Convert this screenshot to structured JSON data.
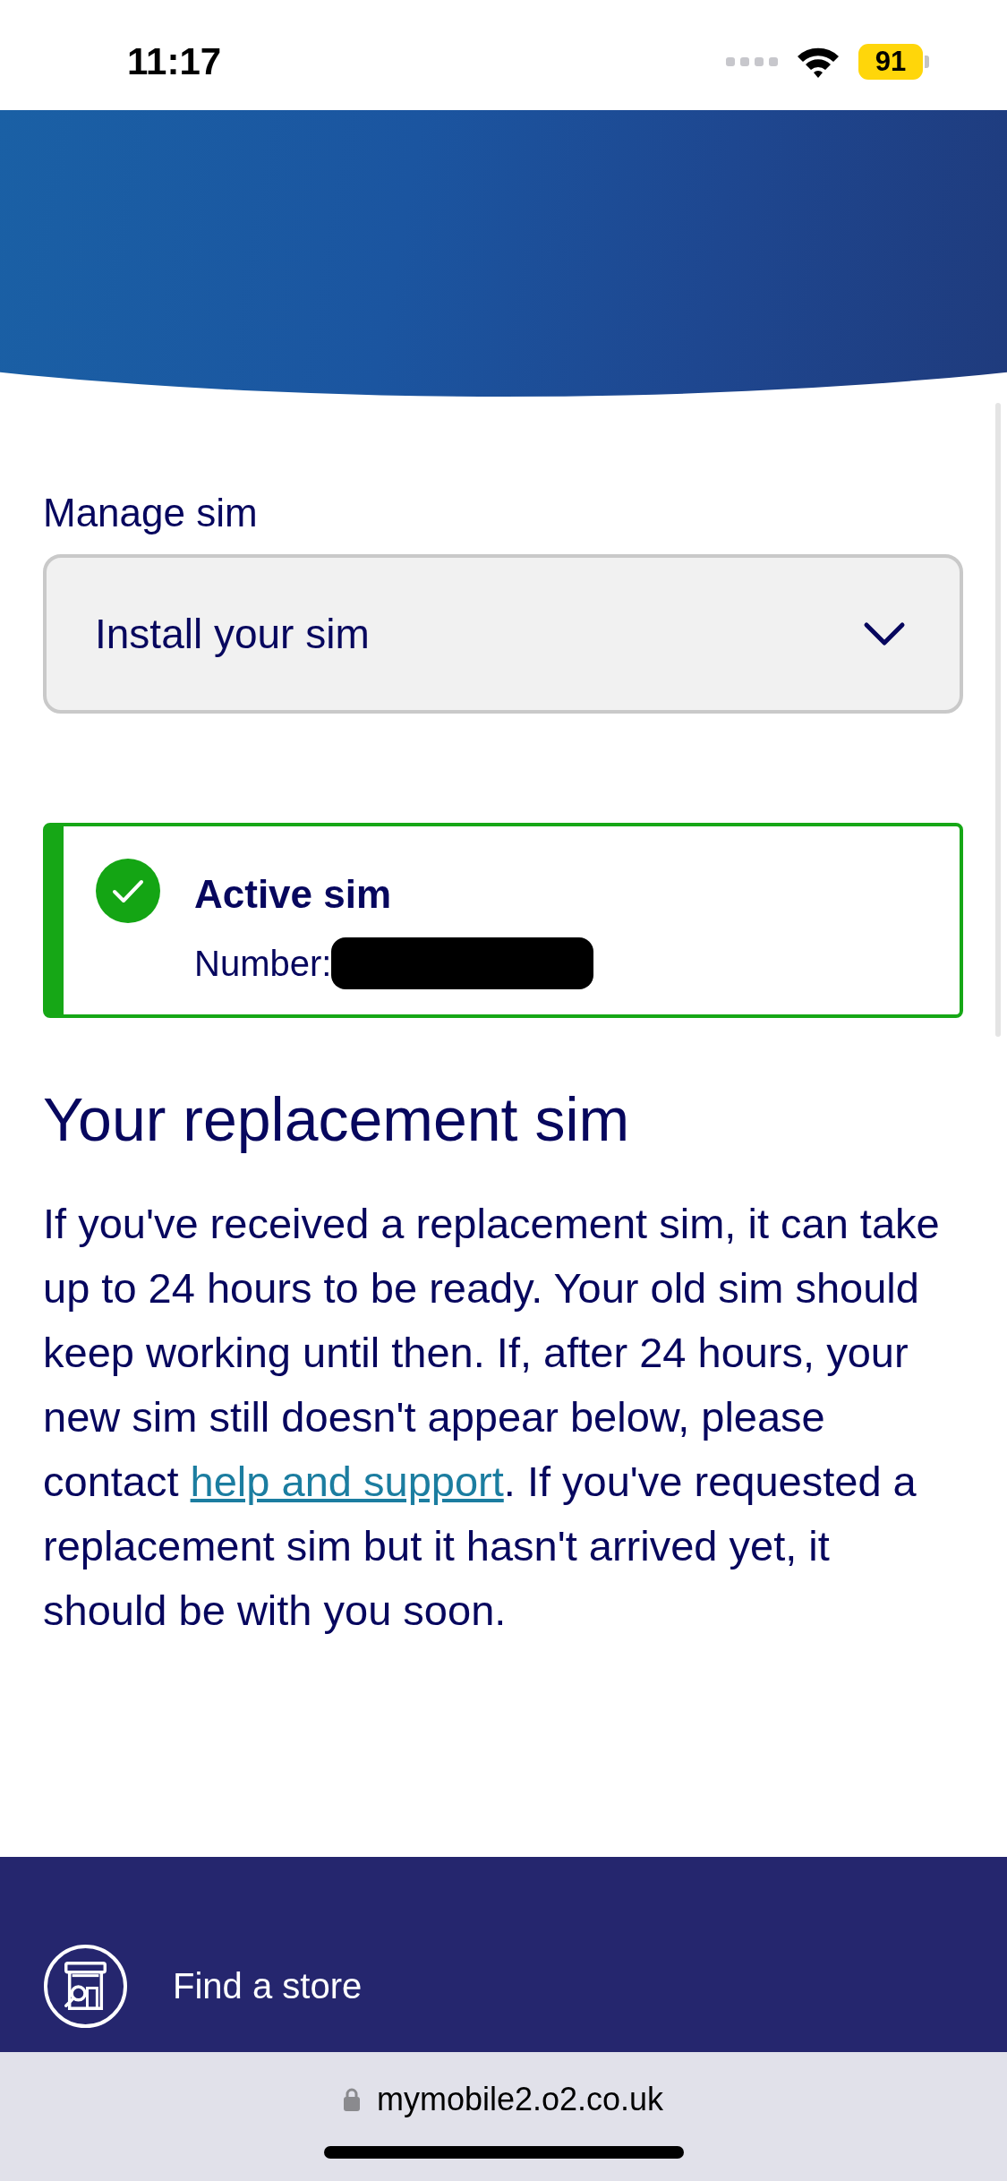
{
  "status_bar": {
    "time": "11:17",
    "battery": "91",
    "low_power_mode": true
  },
  "manage_sim": {
    "label": "Manage sim",
    "dropdown": {
      "value": "Install your sim"
    }
  },
  "sim_card": {
    "title": "Active sim",
    "active": true,
    "number_label": "Number:",
    "number_redacted": true
  },
  "replacement": {
    "heading": "Your replacement sim",
    "text_before": "If you've received a replacement sim, it can take up to 24 hours to be ready. Your old sim should keep working until then. If, after 24 hours, your new sim still doesn't appear below, please contact ",
    "link": "help and support",
    "text_after": ". If you've requested a replacement sim but it hasn't arrived yet, it should be with you soon."
  },
  "footer": {
    "links": [
      {
        "label": "Find a store",
        "kind": "store"
      }
    ]
  },
  "browser_bar": {
    "url": "mymobile2.o2.co.uk",
    "secure": true
  }
}
